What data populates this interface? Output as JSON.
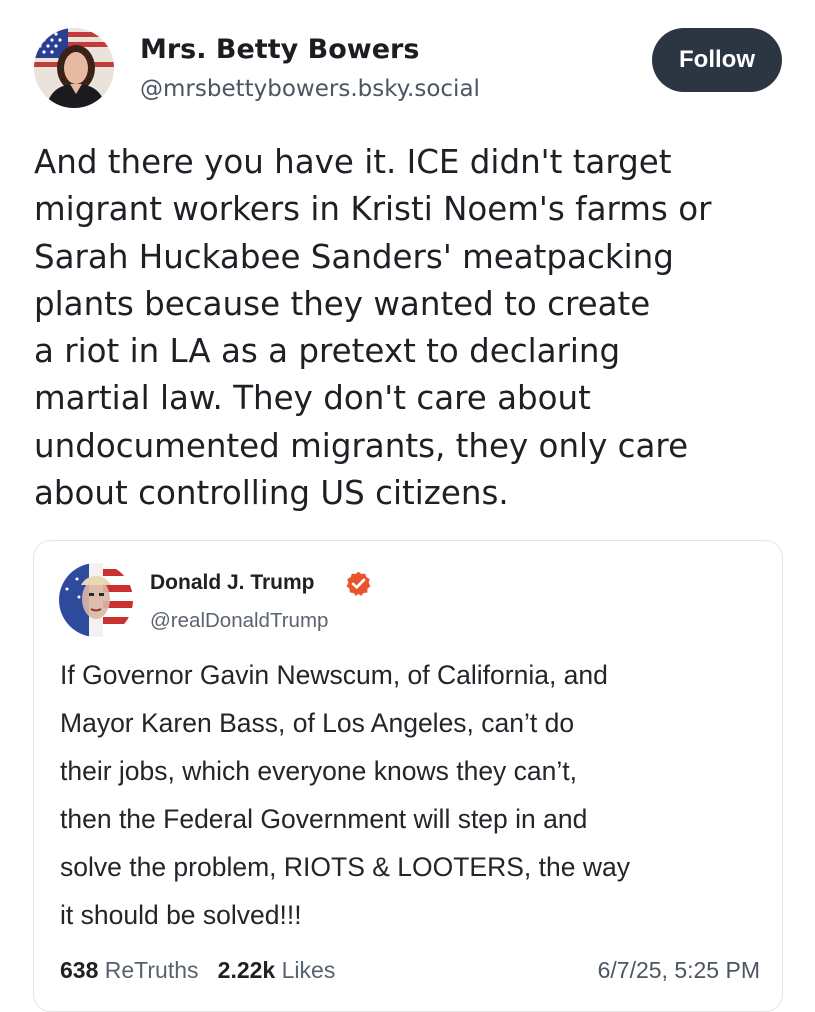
{
  "post": {
    "author_name": "Mrs. Betty Bowers",
    "author_handle": "@mrsbettybowers.bsky.social",
    "follow_label": "Follow",
    "text_lines": [
      "And there you have it. ICE didn't target",
      "migrant workers in Kristi Noem's farms or",
      "Sarah Huckabee Sanders' meatpacking",
      "plants because they wanted to create",
      "a riot in LA as a pretext to declaring",
      "martial law. They don't care about",
      "undocumented migrants, they only care",
      "about controlling US citizens."
    ]
  },
  "quote": {
    "author_name": "Donald J. Trump",
    "author_handle": "@realDonaldTrump",
    "verified_icon": "verified-badge-icon",
    "text_lines": [
      "If Governor Gavin Newscum, of California, and",
      "Mayor Karen Bass, of Los Angeles, can’t do",
      "their jobs, which everyone knows they can’t,",
      "then the Federal Government will step in and",
      "solve the problem, RIOTS & LOOTERS, the way",
      "it should be solved!!!"
    ],
    "retruths_count": "638",
    "retruths_label": "ReTruths",
    "likes_count": "2.22k",
    "likes_label": "Likes",
    "timestamp": "6/7/25, 5:25 PM"
  },
  "colors": {
    "follow_bg": "#2c3542",
    "verified_badge": "#e9532d",
    "text": "#1e2026",
    "muted": "#5b6470"
  }
}
